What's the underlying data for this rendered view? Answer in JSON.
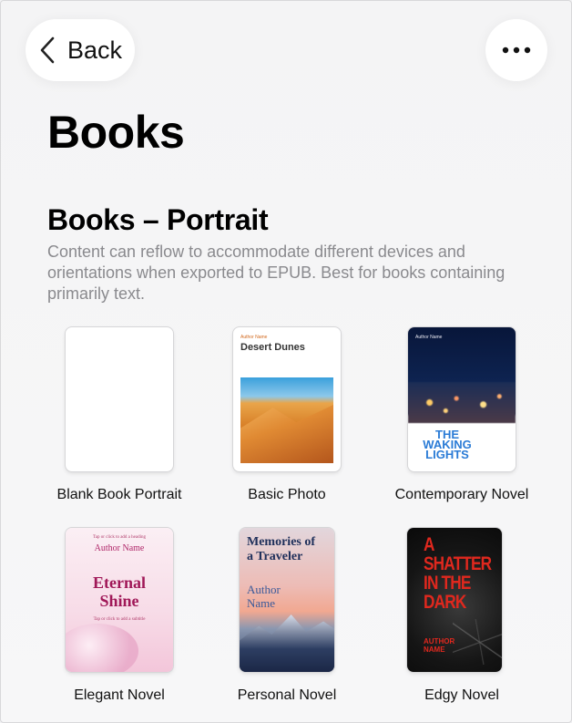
{
  "nav": {
    "back_label": "Back",
    "more_icon": "ellipsis-icon"
  },
  "page": {
    "title": "Books"
  },
  "section": {
    "title": "Books – Portrait",
    "description": "Content can reflow to accommodate different devices and orientations when exported to EPUB. Best for books containing primarily text."
  },
  "templates": [
    {
      "label": "Blank Book Portrait"
    },
    {
      "label": "Basic Photo",
      "cover_caption": "Author Name",
      "cover_title": "Desert Dunes"
    },
    {
      "label": "Contemporary Novel",
      "cover_caption": "Author Name",
      "cover_title": "THE WAKING LIGHTS"
    },
    {
      "label": "Elegant Novel",
      "cover_top_hint": "Tap or click to add a heading",
      "cover_author": "Author Name",
      "cover_title": "Eternal Shine",
      "cover_bottom_hint": "Tap or click to add a subtitle"
    },
    {
      "label": "Personal Novel",
      "cover_title": "Memories of a Traveler",
      "cover_author": "Author Name"
    },
    {
      "label": "Edgy Novel",
      "cover_title": "A SHATTER IN THE DARK",
      "cover_author": "AUTHOR NAME"
    }
  ],
  "colors": {
    "background": "#f4f4f5",
    "button_bg": "#ffffff",
    "desc_gray": "#8a8a8e"
  }
}
